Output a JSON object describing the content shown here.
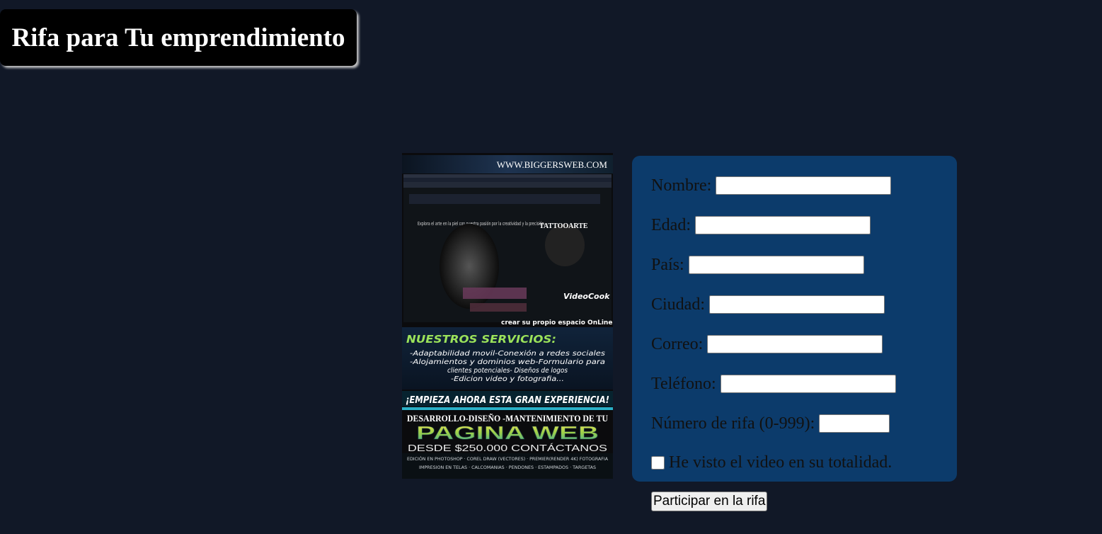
{
  "header": {
    "title": "Rifa para Tu emprendimiento"
  },
  "poster": {
    "site_url": "WWW.BIGGERSWEB.COM",
    "hero_text": "Explora el arte en la piel con nuestra pasión por la creatividad y la precisión.",
    "brand": "TATTOOARTE",
    "watermark": "VideoCook",
    "online_line": "crear su propio espacio OnLine.",
    "services_title": "NUESTROS SERVICIOS:",
    "services_lines": [
      "-Adaptabilidad movil-Conexión a redes sociales",
      "-Alojamientos y dominios web-Formulario para",
      "clientes potenciales- Diseños de logos",
      "-Edicion video y fotografia..."
    ],
    "cta": "¡EMPIEZA AHORA ESTA GRAN EXPERIENCIA!",
    "dev_line": "DESARROLLO-DISEÑO -MANTENIMIENTO DE TU",
    "big_title": "PAGINA WEB",
    "price_line": "DESDE $250.000 CONTÁCTANOS",
    "footer_1": "EDICIÓN EN PHOTOSHOP · COREL DRAW (VECTORES) · PREMIER(RENDER 4K) FOTOGRAFIA",
    "footer_2": "IMPRESION EN TELAS · CALCOMANIAS · PENDONES · ESTAMPADOS · TARGETAS"
  },
  "form": {
    "nombre_label": "Nombre:",
    "edad_label": "Edad:",
    "pais_label": "País:",
    "ciudad_label": "Ciudad:",
    "correo_label": "Correo:",
    "telefono_label": "Teléfono:",
    "numero_label": "Número de rifa (0-999):",
    "checkbox_label": "He visto el video en su totalidad.",
    "submit_label": "Participar en la rifa"
  }
}
